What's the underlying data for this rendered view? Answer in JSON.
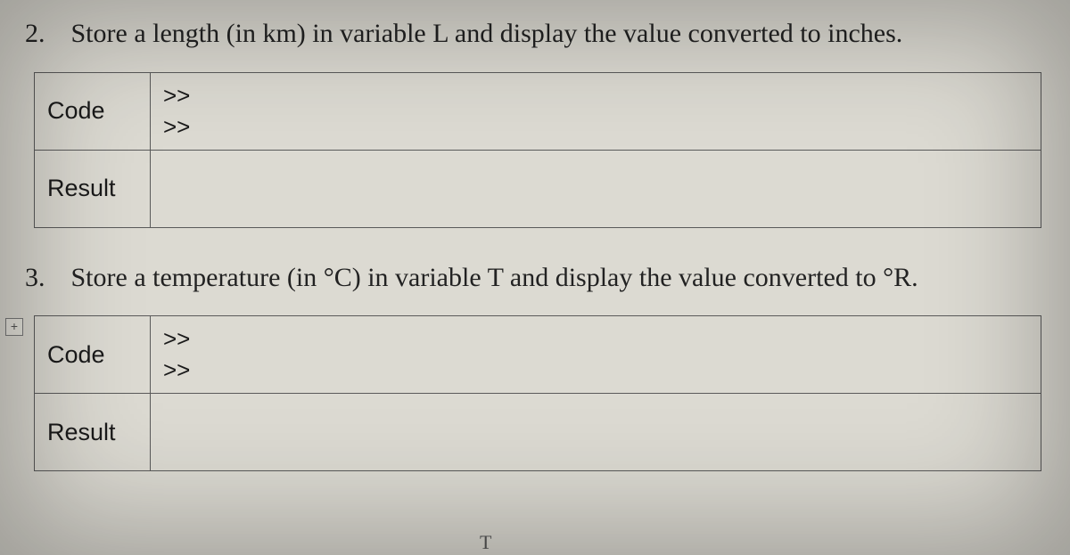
{
  "items": [
    {
      "number": "2.",
      "prompt": "Store a length (in km) in variable L and display the value converted to inches.",
      "code_label": "Code",
      "code_lines": ">>\n>>",
      "result_label": "Result",
      "result_text": ""
    },
    {
      "number": "3.",
      "prompt": "Store a temperature (in °C) in variable T and display the value converted to °R.",
      "code_label": "Code",
      "code_lines": ">>\n>>",
      "result_label": "Result",
      "result_text": ""
    }
  ],
  "anchor_glyph": "+",
  "caret_glyph": "T"
}
